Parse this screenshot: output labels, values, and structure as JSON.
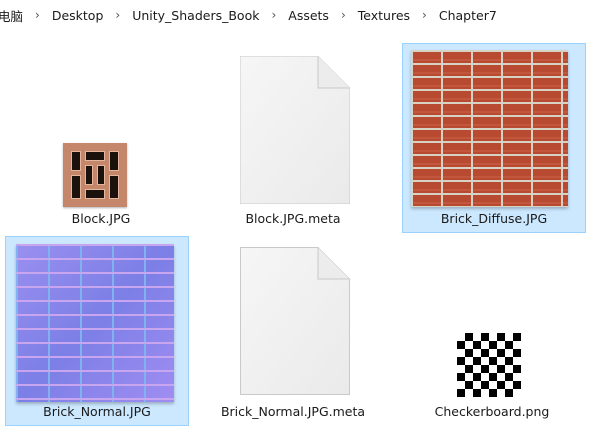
{
  "breadcrumb": {
    "items": [
      "电脑",
      "Desktop",
      "Unity_Shaders_Book",
      "Assets",
      "Textures",
      "Chapter7"
    ],
    "separator": "›"
  },
  "files": [
    {
      "name": "Block.JPG",
      "icon": "block-texture-thumbnail",
      "selected": false
    },
    {
      "name": "Block.JPG.meta",
      "icon": "blank-file-icon",
      "selected": false
    },
    {
      "name": "Brick_Diffuse.JPG",
      "icon": "brick-diffuse-thumbnail",
      "selected": true
    },
    {
      "name": "Brick_Normal.JPG",
      "icon": "brick-normal-thumbnail",
      "selected": true
    },
    {
      "name": "Brick_Normal.JPG.meta",
      "icon": "blank-file-icon",
      "selected": false
    },
    {
      "name": "Checkerboard.png",
      "icon": "checkerboard-thumbnail",
      "selected": false
    }
  ],
  "colors": {
    "selection_bg": "#cce8ff",
    "selection_border": "#99d1ff"
  }
}
